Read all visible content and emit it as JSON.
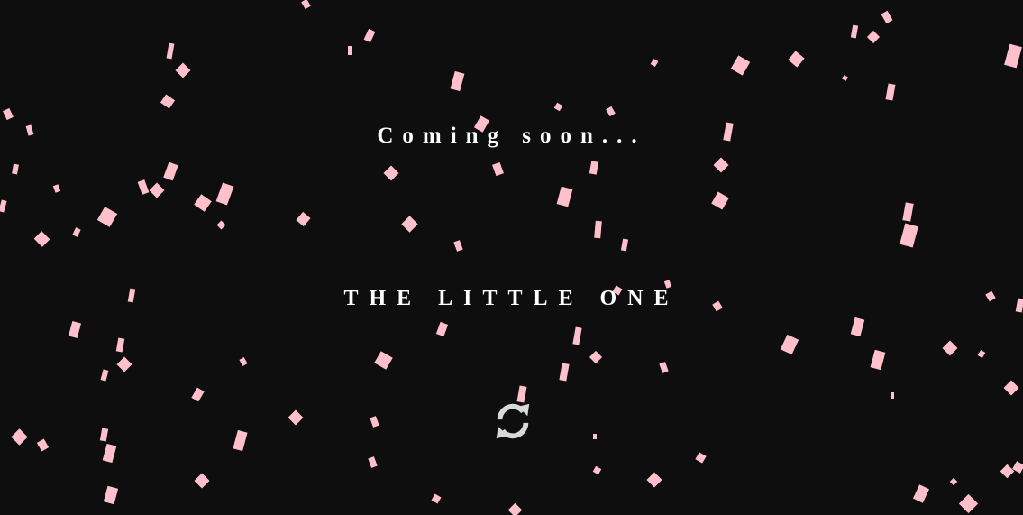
{
  "page": {
    "background_color": "#0e0e0f",
    "confetti_color": "#ffc0cb",
    "coming_soon_text": "Coming soon...",
    "title_text": "THE LITTLE ONE",
    "refresh_icon": "refresh-icon"
  }
}
